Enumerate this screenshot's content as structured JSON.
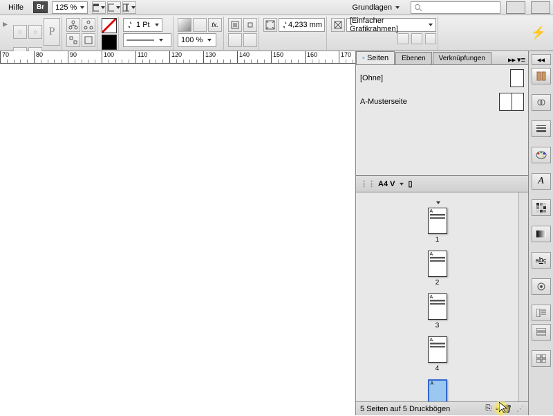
{
  "topbar": {
    "menu_help": "Hilfe",
    "bridge_label": "Br",
    "zoom": "125 %",
    "workspace": "Grundlagen"
  },
  "toolbar": {
    "stroke_weight": "1 Pt",
    "scale_percent": "100 %",
    "frame_size": "4,233 mm",
    "frame_label": "[Einfacher Grafikrahmen]"
  },
  "ruler_marks": [
    "70",
    "80",
    "90",
    "100",
    "110",
    "120",
    "130",
    "140",
    "150",
    "160",
    "170"
  ],
  "panel": {
    "tabs": [
      "Seiten",
      "Ebenen",
      "Verknüpfungen"
    ],
    "master_none": "[Ohne]",
    "master_a": "A-Musterseite",
    "page_size": "A4 V",
    "pages": [
      {
        "num": "1",
        "letter": "A",
        "sel": false
      },
      {
        "num": "2",
        "letter": "A",
        "sel": false
      },
      {
        "num": "3",
        "letter": "A",
        "sel": false
      },
      {
        "num": "4",
        "letter": "A",
        "sel": false
      },
      {
        "num": "",
        "letter": "A",
        "sel": true
      }
    ],
    "status": "5 Seiten auf 5 Druckbögen"
  }
}
